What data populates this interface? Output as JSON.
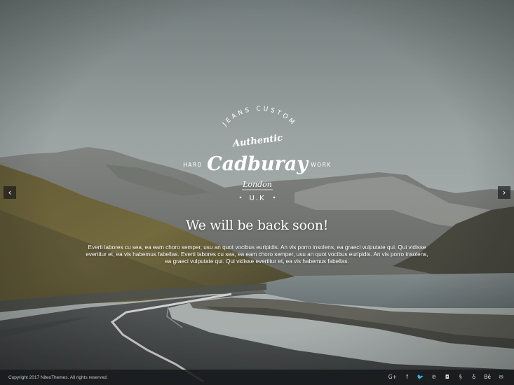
{
  "logo": {
    "arc_text": "JEANS CUSTOM",
    "script_top": "Authentic",
    "left_word": "HARD",
    "right_word": "WORK",
    "brand": "Cadburay",
    "city": "London",
    "country": "U.K"
  },
  "hero": {
    "headline": "We will be back soon!",
    "body": "Everti labores cu sea, ea eam choro semper, usu an quot vocibus euripidis. An vis porro insolens, ea graeci vulputate qui. Qui vidisse evertitur et, ea vis habemus fabellas. Everti labores cu sea, ea eam choro semper, usu an quot vocibus euripidis. An vis porro insolens, ea graeci vulputate qui. Qui vidisse evertitur et, ea vis habemus fabellas."
  },
  "slider": {
    "prev_glyph": "‹",
    "next_glyph": "›"
  },
  "footer": {
    "copyright": "Copyright 2017 NiteoThemes. All rights reserved.",
    "socials": [
      {
        "icon": "google-plus-icon",
        "glyph": "G+"
      },
      {
        "icon": "facebook-icon",
        "glyph": "f"
      },
      {
        "icon": "twitter-icon",
        "glyph": "🐦"
      },
      {
        "icon": "pinterest-icon",
        "glyph": "℗"
      },
      {
        "icon": "instagram-icon",
        "glyph": "◘"
      },
      {
        "icon": "foursquare-icon",
        "glyph": "§"
      },
      {
        "icon": "vine-icon",
        "glyph": "♁"
      },
      {
        "icon": "behance-icon",
        "glyph": "Bē"
      },
      {
        "icon": "email-icon",
        "glyph": "✉"
      }
    ]
  }
}
